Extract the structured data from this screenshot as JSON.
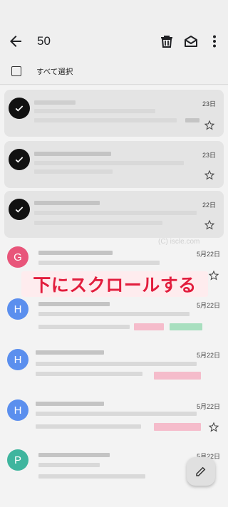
{
  "toolbar": {
    "selected_count": "50",
    "icons": [
      "arrow-back-icon",
      "trash-icon",
      "mark-read-icon",
      "more-vert-icon"
    ]
  },
  "select_all": {
    "label": "すべて選択"
  },
  "messages": [
    {
      "avatar": "",
      "selected": true,
      "date": "23日"
    },
    {
      "avatar": "",
      "selected": true,
      "date": "23日"
    },
    {
      "avatar": "",
      "selected": true,
      "date": "22日"
    },
    {
      "avatar": "G",
      "selected": false,
      "date": "5月22日",
      "color": "#e8557a"
    },
    {
      "avatar": "H",
      "selected": false,
      "date": "5月22日",
      "color": "#5b8fee"
    },
    {
      "avatar": "H",
      "selected": false,
      "date": "5月22日",
      "color": "#5b8fee"
    },
    {
      "avatar": "H",
      "selected": false,
      "date": "5月22日",
      "color": "#5b8fee"
    },
    {
      "avatar": "P",
      "selected": false,
      "date": "5月22日",
      "color": "#3fb59e"
    }
  ],
  "overlay_caption": "下にスクロールする",
  "watermark": "(C) iscle.com",
  "fab": {
    "icon": "pencil-icon"
  }
}
